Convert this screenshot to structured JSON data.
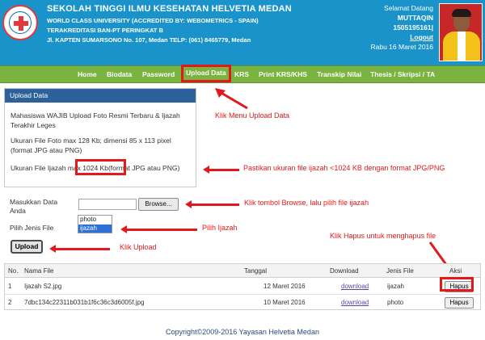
{
  "header": {
    "school_name": "SEKOLAH TINGGI ILMU KESEHATAN HELVETIA MEDAN",
    "line1": "WORLD CLASS UNIVERSITY (ACCREDITED BY: WEBOMETRICS - SPAIN)",
    "line2": "TERAKREDITASI BAN-PT PERINGKAT B",
    "line3": "Jl. KAPTEN SUMARSONO No. 107, Medan TELP: (061) 8465779, Medan",
    "welcome": "Selamat Datang",
    "username": "MUTTAQIN",
    "student_id": "1505195161|",
    "logout": "Logout",
    "date": "Rabu 16 Maret 2016",
    "brand_color": "#1993c9"
  },
  "nav": {
    "items": [
      "Home",
      "Biodata",
      "Password",
      "Upload Data",
      "KRS",
      "Print KRS/KHS",
      "Transkip Nilai",
      "Thesis / Skripsi / TA"
    ],
    "active": "Upload Data",
    "color": "#7ab33f"
  },
  "panel": {
    "title": "Upload Data",
    "para1": "Mahasiswa WAJIB Upload Foto Resmi Terbaru & Ijazah Terakhir Leges",
    "para2": "Ukuran File Foto max 128 Kb; dimensi 85 x 113 pixel (format JPG atau PNG)",
    "para3": "Ukuran File Ijazah max 1024 Kb(format JPG atau PNG)"
  },
  "form": {
    "file_label": "Masukkan Data Anda",
    "browse_label": "Browse...",
    "type_label": "Pilih Jenis File",
    "options": [
      "photo",
      "ijazah"
    ],
    "selected_option": "ijazah",
    "upload_label": "Upload"
  },
  "table": {
    "headers": [
      "No.",
      "Nama File",
      "Tanggal",
      "Download",
      "Jenis File",
      "Aksi"
    ],
    "rows": [
      {
        "no": "1",
        "name": "Ijazah S2.jpg",
        "date": "12 Maret 2016",
        "download": "download",
        "type": "ijazah",
        "action": "Hapus"
      },
      {
        "no": "2",
        "name": "7dbc134c22311b031b1f6c36c3d6005f.jpg",
        "date": "10 Maret 2016",
        "download": "download",
        "type": "photo",
        "action": "Hapus"
      }
    ]
  },
  "footer": "Copyright©2009-2016 Yayasan Helvetia Medan",
  "annotations": {
    "menu": "Klik Menu Upload Data",
    "size": "Pastikan ukuran file ijazah <1024 KB dengan format JPG/PNG",
    "browse": "Klik tombol Browse, lalu pilih file ijazah",
    "select": "Pilih Ijazah",
    "upload": "Klik Upload",
    "delete": "Klik Hapus untuk menghapus file",
    "color": "#e1191c"
  }
}
